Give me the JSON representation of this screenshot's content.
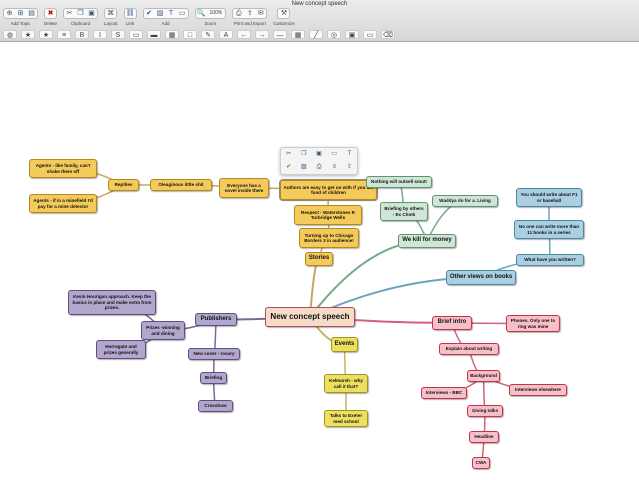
{
  "window": {
    "title": "New concept speech"
  },
  "toolbar": {
    "groups": [
      {
        "label": "Add Topic",
        "icons": [
          "add-topic-icon",
          "add-subtopic-icon",
          "add-callout-icon"
        ]
      },
      {
        "label": "Delete",
        "icons": [
          "delete-icon"
        ]
      },
      {
        "label": "Clipboard",
        "icons": [
          "cut-icon",
          "copy-icon",
          "paste-icon"
        ]
      },
      {
        "label": "Layout",
        "icons": [
          "layout-icon"
        ]
      },
      {
        "label": "Link",
        "icons": [
          "link-icon"
        ]
      },
      {
        "label": "Add",
        "icons": [
          "task-icon",
          "image-icon",
          "text-icon",
          "note-icon"
        ]
      },
      {
        "label": "Zoom",
        "icons": [
          "zoom-icon"
        ],
        "value": "100%"
      },
      {
        "label": "Print and Export",
        "icons": [
          "print-icon",
          "export-icon",
          "share-icon"
        ]
      },
      {
        "label": "Customize",
        "icons": [
          "customize-icon"
        ]
      }
    ],
    "format_icons": [
      "theme-icon",
      "star-icon",
      "star-add-icon",
      "align-icon",
      "bold-icon",
      "italic-icon",
      "strike-icon",
      "shape-icon",
      "line-style-icon",
      "fill-icon",
      "border-icon",
      "pen-icon",
      "font-color-icon",
      "arrow-left-icon",
      "arrow-right-icon",
      "line-icon",
      "grid-icon",
      "slash-icon",
      "color-wheel-icon",
      "style-icon",
      "note-icon",
      "eraser-icon"
    ]
  },
  "mindmap": {
    "colors": {
      "yellow": "#f4cb5a",
      "green": "#cfe6d6",
      "blue": "#a9cfe0",
      "purple": "#b3a6cc",
      "lyellow": "#ede060",
      "pink": "#f6c0c8",
      "center": "#f6dcc6"
    },
    "nodes": [
      {
        "id": "root",
        "text": "New concept speech",
        "theme": "peach"
      },
      {
        "id": "stories",
        "text": "Stories",
        "theme": "yellow",
        "parent": "root"
      },
      {
        "id": "turning",
        "text": "Turning up to Chicago Borders 3 in audience!",
        "theme": "yellow",
        "parent": "stories"
      },
      {
        "id": "respect",
        "text": "Respect - Waterstones R Turbridge Wells",
        "theme": "yellow",
        "parent": "turning"
      },
      {
        "id": "authors",
        "text": "Authors are easy to get on with if you are fond of children",
        "theme": "yellow",
        "parent": "respect",
        "selected": true
      },
      {
        "id": "everyone",
        "text": "Everyone has a novel inside them",
        "theme": "yellow",
        "parent": "authors"
      },
      {
        "id": "oleag",
        "text": "Oleaginous little shit",
        "theme": "yellow",
        "parent": "everyone"
      },
      {
        "id": "reptiles",
        "text": "Reptiles",
        "theme": "yellow",
        "parent": "oleag"
      },
      {
        "id": "agents1",
        "text": "Agents - like family, can't shake them off",
        "theme": "yellow",
        "parent": "reptiles"
      },
      {
        "id": "agents2",
        "text": "Agents - if in a minefield I'd pay for a mine detector",
        "theme": "yellow",
        "parent": "reptiles"
      },
      {
        "id": "money",
        "text": "We kill for money",
        "theme": "green",
        "parent": "root"
      },
      {
        "id": "briefing_others",
        "text": "Briefing by others - Ex Chmb",
        "theme": "green",
        "parent": "money"
      },
      {
        "id": "nothing",
        "text": "Nothing will outsell smut!",
        "theme": "green",
        "parent": "briefing_others"
      },
      {
        "id": "waddya",
        "text": "Waddya do for a. Living",
        "theme": "green",
        "parent": "money"
      },
      {
        "id": "views",
        "text": "Other views on books",
        "theme": "blue",
        "parent": "root"
      },
      {
        "id": "written",
        "text": "What have you written?",
        "theme": "blue",
        "parent": "views"
      },
      {
        "id": "noone",
        "text": "No one can write more than 11 books in a series",
        "theme": "blue",
        "parent": "written"
      },
      {
        "id": "f1",
        "text": "You should write about F1 or baseball",
        "theme": "blue",
        "parent": "noone"
      },
      {
        "id": "publishers",
        "text": "Publishers",
        "theme": "purple",
        "parent": "root"
      },
      {
        "id": "prizes",
        "text": "Prizes -winning and dining",
        "theme": "purple",
        "parent": "publishers"
      },
      {
        "id": "kevin",
        "text": "Kevin Hourigan approach. Keep the basics in place and make extra from prizes.",
        "theme": "purple",
        "parent": "prizes"
      },
      {
        "id": "horrogate",
        "text": "Horrogate and prizes generally",
        "theme": "purple",
        "parent": "prizes"
      },
      {
        "id": "newcover",
        "text": "New cover - rosary",
        "theme": "purple",
        "parent": "publishers"
      },
      {
        "id": "briefing",
        "text": "Briefing",
        "theme": "purple",
        "parent": "newcover"
      },
      {
        "id": "crossbow",
        "text": "Crossbow",
        "theme": "purple",
        "parent": "briefing"
      },
      {
        "id": "events",
        "text": "Events",
        "theme": "lyellow",
        "parent": "root"
      },
      {
        "id": "kelmarsh",
        "text": "Kelmarsh - why call it that?",
        "theme": "lyellow",
        "parent": "events"
      },
      {
        "id": "exeter",
        "text": "Talks to Exeter med school",
        "theme": "lyellow",
        "parent": "kelmarsh"
      },
      {
        "id": "intro",
        "text": "Brief intro",
        "theme": "pink",
        "parent": "root"
      },
      {
        "id": "phones",
        "text": "Phones. Only one to ring was mine",
        "theme": "pink",
        "parent": "intro"
      },
      {
        "id": "explain",
        "text": "Explain about writing",
        "theme": "pink",
        "parent": "intro"
      },
      {
        "id": "background",
        "text": "Background",
        "theme": "pink",
        "parent": "explain"
      },
      {
        "id": "bbc",
        "text": "Interviews - BBC",
        "theme": "pink",
        "parent": "background"
      },
      {
        "id": "elsewhere",
        "text": "Interviews elsewhere",
        "theme": "pink",
        "parent": "background"
      },
      {
        "id": "talks",
        "text": "Giving talks",
        "theme": "pink",
        "parent": "background"
      },
      {
        "id": "headline",
        "text": "Headline",
        "theme": "pink",
        "parent": "talks"
      },
      {
        "id": "cwa",
        "text": "CWA",
        "theme": "pink",
        "parent": "headline"
      }
    ]
  },
  "popup": {
    "icons": [
      "cut-icon",
      "copy-icon",
      "paste-icon",
      "note-icon",
      "text-icon",
      "task-icon",
      "image-icon",
      "print-icon",
      "list-icon",
      "export-icon"
    ]
  }
}
